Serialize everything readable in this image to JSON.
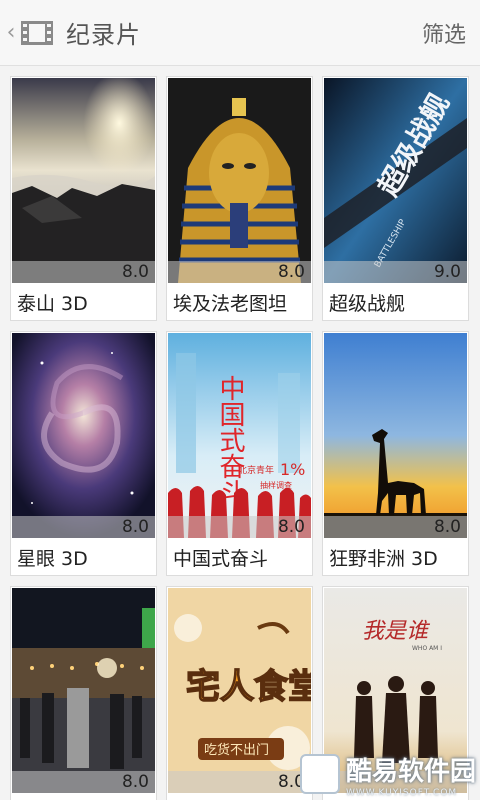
{
  "header": {
    "title": "纪录片",
    "filter_label": "筛选"
  },
  "items": [
    {
      "name": "泰山 3D",
      "rating": "8.0"
    },
    {
      "name": "埃及法老图坦",
      "rating": "8.0"
    },
    {
      "name": "超级战舰",
      "rating": "9.0"
    },
    {
      "name": "星眼 3D",
      "rating": "8.0"
    },
    {
      "name": "中国式奋斗",
      "rating": "8.0"
    },
    {
      "name": "狂野非洲 3D",
      "rating": "8.0"
    },
    {
      "name": "",
      "rating": "8.0"
    },
    {
      "name": "",
      "rating": "8.0"
    },
    {
      "name": "",
      "rating": ""
    }
  ],
  "posters": {
    "zhongguo": {
      "main": "中国式奋斗",
      "sub": "北京青年",
      "pct": "1%",
      "sub2": "抽样调查"
    },
    "zhaiqi": {
      "main": "宅人食堂",
      "sub": "吃货不出门"
    },
    "woshishui": {
      "main": "我是谁",
      "sub": "WHO AM I"
    },
    "chaoji": {
      "main": "超级战舰",
      "sub": "BATTLESHIP"
    }
  },
  "watermark": {
    "main": "酷易软件园",
    "sub": "WWW.KUYISOFT.COM"
  }
}
